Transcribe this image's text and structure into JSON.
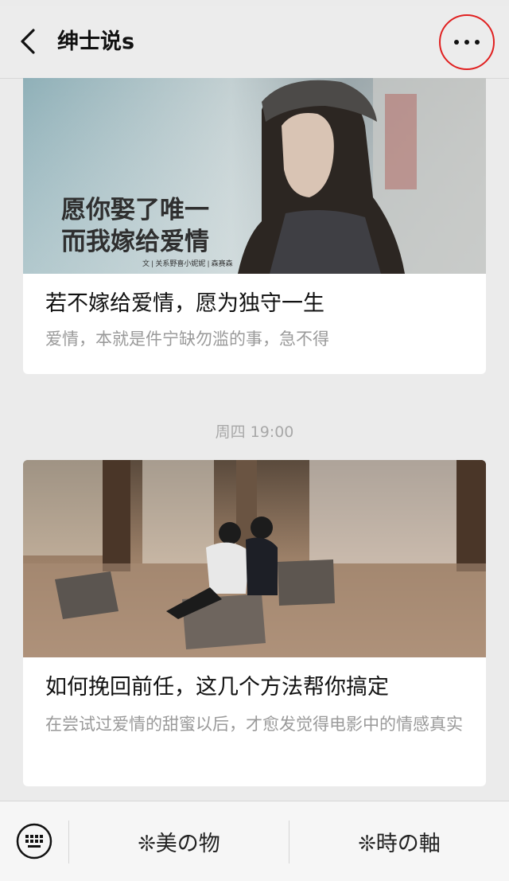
{
  "nav": {
    "title": "绅士说s",
    "back_icon": "chevron-left-icon",
    "more_icon": "more-dots-icon",
    "highlight_color": "#e02020"
  },
  "articles": [
    {
      "image_caption_line1": "愿你娶了唯一",
      "image_caption_line2": "而我嫁给爱情",
      "image_credit": "文 | 关系野喜小妮妮 | 森赛森",
      "title": "若不嫁给爱情，愿为独守一生",
      "description": "爱情，本就是件宁缺勿滥的事，急不得"
    },
    {
      "title": "如何挽回前任，这几个方法帮你搞定",
      "description": "在尝试过爱情的甜蜜以后，才愈发觉得电影中的情感真实"
    }
  ],
  "timestamp": "周四 19:00",
  "bottom_menu": {
    "keyboard_icon": "keyboard-icon",
    "items": [
      {
        "label": "❊美の物"
      },
      {
        "label": "❊時の軸"
      }
    ]
  }
}
